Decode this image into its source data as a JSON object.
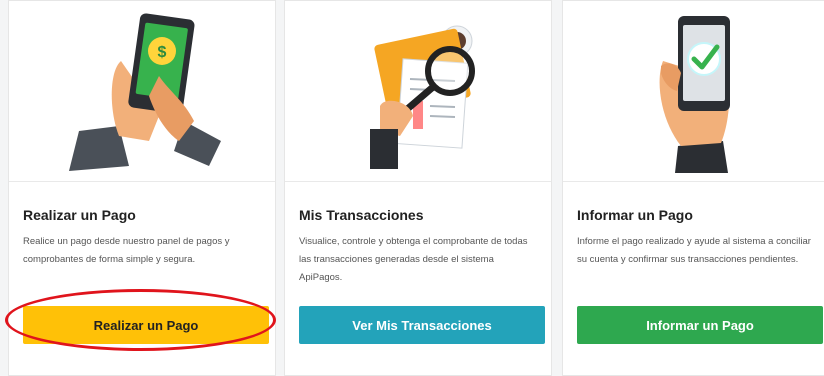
{
  "cards": [
    {
      "title": "Realizar un Pago",
      "description": "Realice un pago desde nuestro panel de pagos y comprobantes de forma simple y segura.",
      "button_label": "Realizar un Pago",
      "illustration": "hand-phone-payment-icon"
    },
    {
      "title": "Mis Transacciones",
      "description": "Visualice, controle y obtenga el comprobante de todas las transacciones generadas desde el sistema ApiPagos.",
      "button_label": "Ver Mis Transacciones",
      "illustration": "magnifier-document-icon"
    },
    {
      "title": "Informar un Pago",
      "description": "Informe el pago realizado y ayude al sistema a conciliar su cuenta y confirmar sus transacciones pendientes.",
      "button_label": "Informar un Pago",
      "illustration": "hand-phone-check-icon"
    }
  ],
  "colors": {
    "realizar_button": "#ffc107",
    "transacciones_button": "#23a3ba",
    "informar_button": "#2ea84f",
    "highlight_circle": "#e0141c"
  }
}
